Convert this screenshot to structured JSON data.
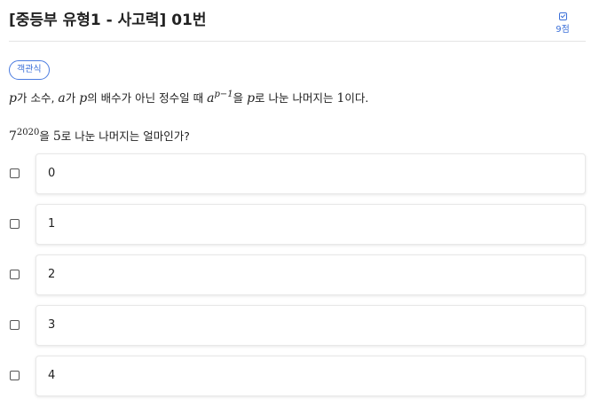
{
  "header": {
    "title": "[중등부 유형1 - 사고력] 01번",
    "score": "9점",
    "score_icon": "checkbox-icon"
  },
  "question": {
    "type_badge": "객관식",
    "line1": {
      "p1": "p",
      "t1": "가 소수, ",
      "a1": "a",
      "t2": "가 ",
      "p2": "p",
      "t3": "의 배수가 아닌 정수일 때 ",
      "a2": "a",
      "exp": "p−1",
      "t4": "을 ",
      "p3": "p",
      "t5": "로 나눈 나머지는 ",
      "one": "1",
      "t6": "이다."
    },
    "line2": {
      "base": "7",
      "exp": "2020",
      "t1": "을 ",
      "five": "5",
      "t2": "로 나눈 나머지는 얼마인가?"
    }
  },
  "options": [
    {
      "label": "0"
    },
    {
      "label": "1"
    },
    {
      "label": "2"
    },
    {
      "label": "3"
    },
    {
      "label": "4"
    }
  ],
  "colors": {
    "accent": "#3b6fd8",
    "badge_border": "#4a7be0",
    "divider": "#e4e4e4"
  }
}
